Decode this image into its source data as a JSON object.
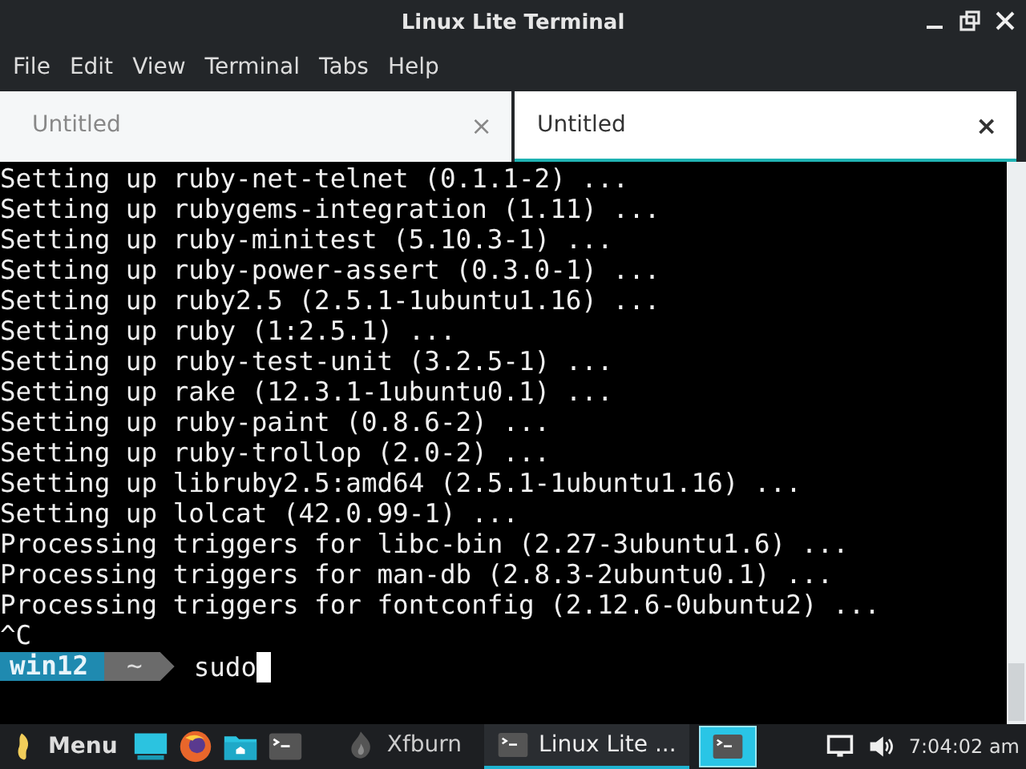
{
  "window": {
    "title": "Linux Lite Terminal"
  },
  "menu": [
    "File",
    "Edit",
    "View",
    "Terminal",
    "Tabs",
    "Help"
  ],
  "tabs": [
    {
      "label": "Untitled",
      "selected": false,
      "close": "×"
    },
    {
      "label": "Untitled",
      "selected": true,
      "close": "×"
    }
  ],
  "terminal": {
    "lines": [
      "Setting up ruby-net-telnet (0.1.1-2) ...",
      "Setting up rubygems-integration (1.11) ...",
      "Setting up ruby-minitest (5.10.3-1) ...",
      "Setting up ruby-power-assert (0.3.0-1) ...",
      "Setting up ruby2.5 (2.5.1-1ubuntu1.16) ...",
      "Setting up ruby (1:2.5.1) ...",
      "Setting up ruby-test-unit (3.2.5-1) ...",
      "Setting up rake (12.3.1-1ubuntu0.1) ...",
      "Setting up ruby-paint (0.8.6-2) ...",
      "Setting up ruby-trollop (2.0-2) ...",
      "Setting up libruby2.5:amd64 (2.5.1-1ubuntu1.16) ...",
      "Setting up lolcat (42.0.99-1) ...",
      "Processing triggers for libc-bin (2.27-3ubuntu1.6) ...",
      "Processing triggers for man-db (2.8.3-2ubuntu0.1) ...",
      "Processing triggers for fontconfig (2.12.6-0ubuntu2) ...",
      "^C"
    ],
    "prompt": {
      "host": "win12",
      "dir": "~",
      "input": "sudo"
    }
  },
  "taskbar": {
    "menu_label": "Menu",
    "launchers": [
      {
        "kind": "display"
      },
      {
        "kind": "browser"
      },
      {
        "kind": "folder"
      },
      {
        "kind": "terminal"
      }
    ],
    "tasks": [
      {
        "label": "Xfburn",
        "kind": "flame",
        "selected": false
      },
      {
        "label": "Linux Lite ...",
        "kind": "terminal",
        "selected": true
      }
    ],
    "pager": {
      "selected": true
    },
    "clock": "7:04:02 am"
  }
}
